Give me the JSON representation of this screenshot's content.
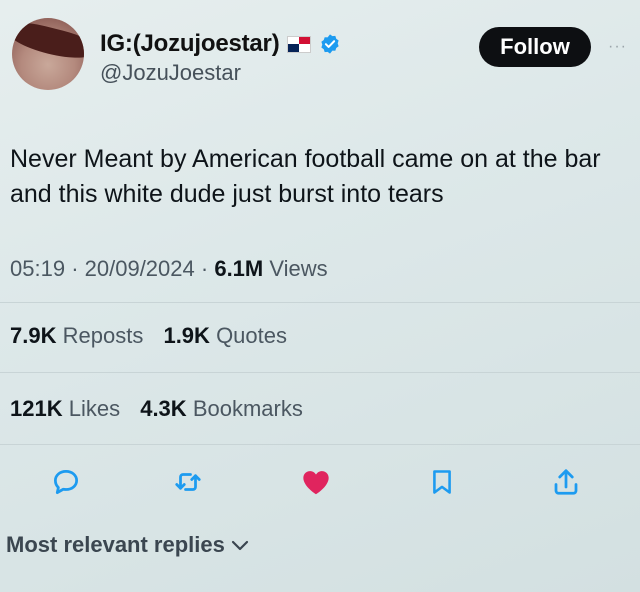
{
  "user": {
    "display_name": "IG:(Jozujoestar)",
    "handle": "@JozuJoestar",
    "flag_icon": "panama-flag-icon",
    "verified_icon": "verified-badge-icon"
  },
  "header": {
    "follow_label": "Follow",
    "more_label": "···"
  },
  "tweet": {
    "text": "Never Meant by American football came on at the bar and this white dude just burst into tears"
  },
  "meta": {
    "time": "05:19",
    "date": "20/09/2024",
    "views_count": "6.1M",
    "views_label": "Views",
    "separator": "·"
  },
  "stats": {
    "reposts_count": "7.9K",
    "reposts_label": "Reposts",
    "quotes_count": "1.9K",
    "quotes_label": "Quotes",
    "likes_count": "121K",
    "likes_label": "Likes",
    "bookmarks_count": "4.3K",
    "bookmarks_label": "Bookmarks"
  },
  "actions": [
    {
      "icon": "reply-icon"
    },
    {
      "icon": "retweet-icon"
    },
    {
      "icon": "like-icon-filled"
    },
    {
      "icon": "bookmark-icon"
    },
    {
      "icon": "share-icon"
    }
  ],
  "replies": {
    "label": "Most relevant replies",
    "chevron": "chevron-down-icon"
  },
  "colors": {
    "like": "#e0245e",
    "verified": "#1d9bf0",
    "follow_bg": "#0d0f12",
    "muted_text": "#4b5761"
  }
}
